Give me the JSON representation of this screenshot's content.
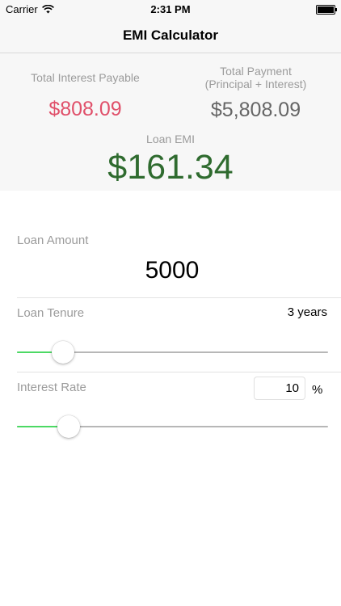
{
  "status_bar": {
    "carrier": "Carrier",
    "time": "2:31 PM",
    "battery_level": 1.0
  },
  "nav": {
    "title": "EMI Calculator"
  },
  "summary": {
    "interest_label": "Total Interest Payable",
    "interest_value": "$808.09",
    "payment_label_line1": "Total Payment",
    "payment_label_line2": "(Principal + Interest)",
    "payment_value": "$5,808.09",
    "emi_label": "Loan EMI",
    "emi_value": "$161.34"
  },
  "form": {
    "amount_label": "Loan Amount",
    "amount_value": "5000",
    "tenure_label": "Loan Tenure",
    "tenure_value": "3 years",
    "tenure_slider_fraction": 0.12,
    "rate_label": "Interest Rate",
    "rate_value": "10",
    "rate_unit": "%",
    "rate_slider_fraction": 0.14
  },
  "colors": {
    "interest": "#e0506a",
    "emi": "#2f6b2f",
    "slider_fill": "#4cd964"
  }
}
